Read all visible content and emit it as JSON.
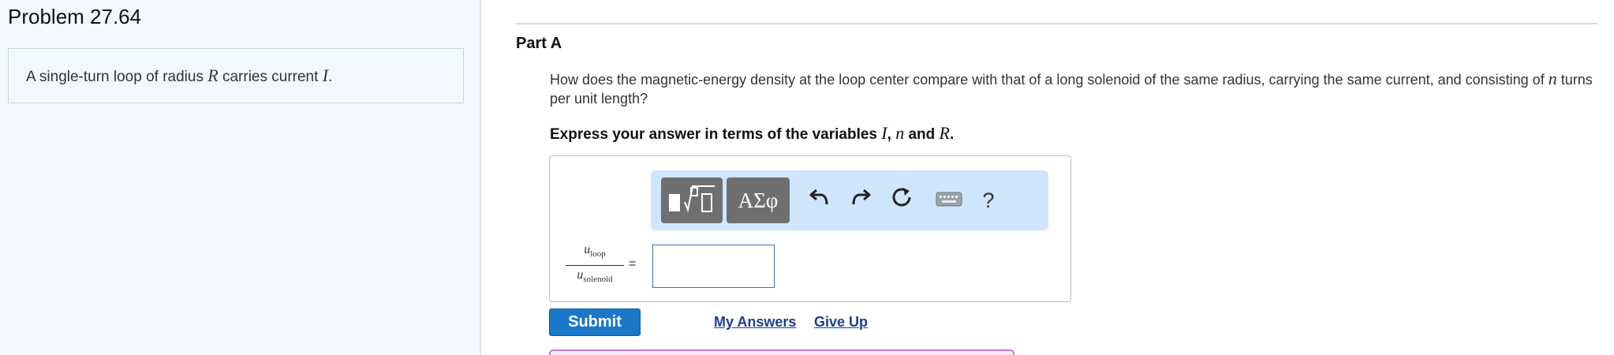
{
  "left_panel": {
    "problem_title": "Problem 27.64",
    "context": {
      "text_before": "A single-turn loop of radius ",
      "var_radius": "R",
      "text_middle": " carries current ",
      "var_current": "I",
      "text_after": "."
    }
  },
  "part": {
    "title": "Part A",
    "question": {
      "text_before": "How does the magnetic-energy density at the loop center compare with that of a long solenoid of the same radius, carrying the same current, and consisting of ",
      "var_n": "n",
      "text_after": " turns per unit length?"
    },
    "instruction": {
      "text_before": "Express your answer in terms of the variables ",
      "var_1": "I",
      "sep": ", ",
      "var_2": "n",
      "and": " and ",
      "var_3": "R",
      "text_after": "."
    }
  },
  "toolbar": {
    "templates_icon": "templates-icon",
    "symbols_label": "ΑΣφ",
    "undo_icon": "undo-icon",
    "redo_icon": "redo-icon",
    "reset_icon": "reset-icon",
    "keyboard_icon": "keyboard-icon",
    "help_label": "?"
  },
  "answer": {
    "numerator": {
      "base": "u",
      "sub": "loop"
    },
    "denominator": {
      "base": "u",
      "sub": "solenoid"
    },
    "equals": "=",
    "input_value": ""
  },
  "actions": {
    "submit_label": "Submit",
    "my_answers_label": "My Answers",
    "give_up_label": "Give Up"
  },
  "colors": {
    "left_panel_bg": "#f2f8fd",
    "toolbar_bg": "#cfe5fb",
    "submit_bg": "#1b78c9",
    "link": "#1a3f8f",
    "feedback_border": "#c07dd0"
  }
}
